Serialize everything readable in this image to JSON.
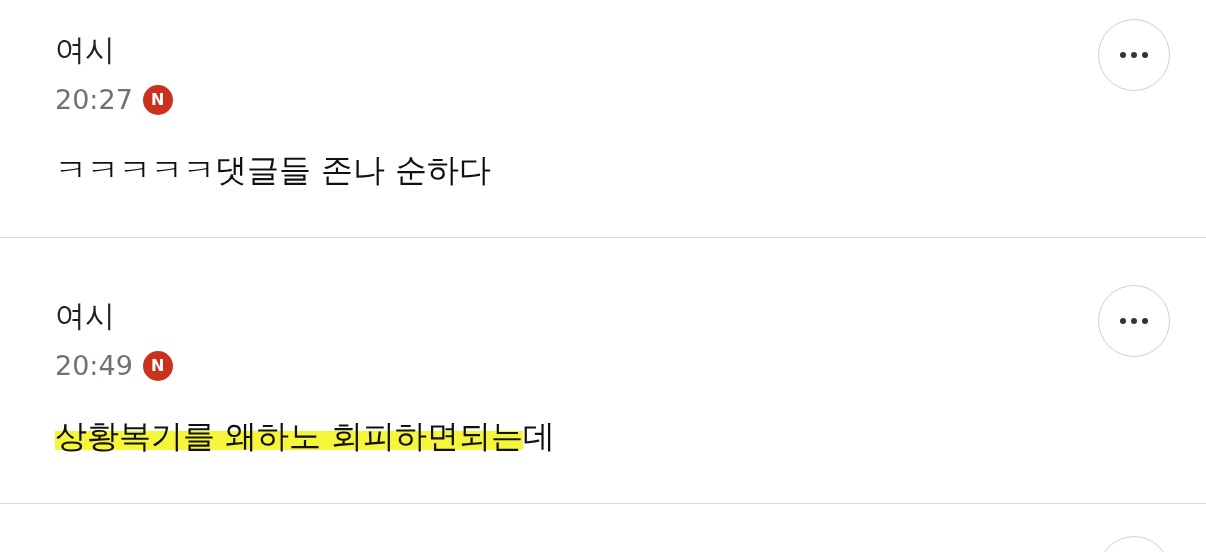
{
  "comments": [
    {
      "kind": "comment",
      "author": "여시",
      "time": "20:27",
      "new_badge": "N",
      "body": [
        {
          "text": "ㅋㅋㅋㅋㅋ댓글들 존나 순하다",
          "highlighted": false
        }
      ]
    },
    {
      "kind": "comment",
      "author": "여시",
      "time": "20:49",
      "new_badge": "N",
      "body": [
        {
          "text": "상황복기를 왜하노 회피하면되는",
          "highlighted": true
        },
        {
          "text": "데",
          "highlighted": false
        }
      ]
    },
    {
      "kind": "cutoff"
    }
  ]
}
